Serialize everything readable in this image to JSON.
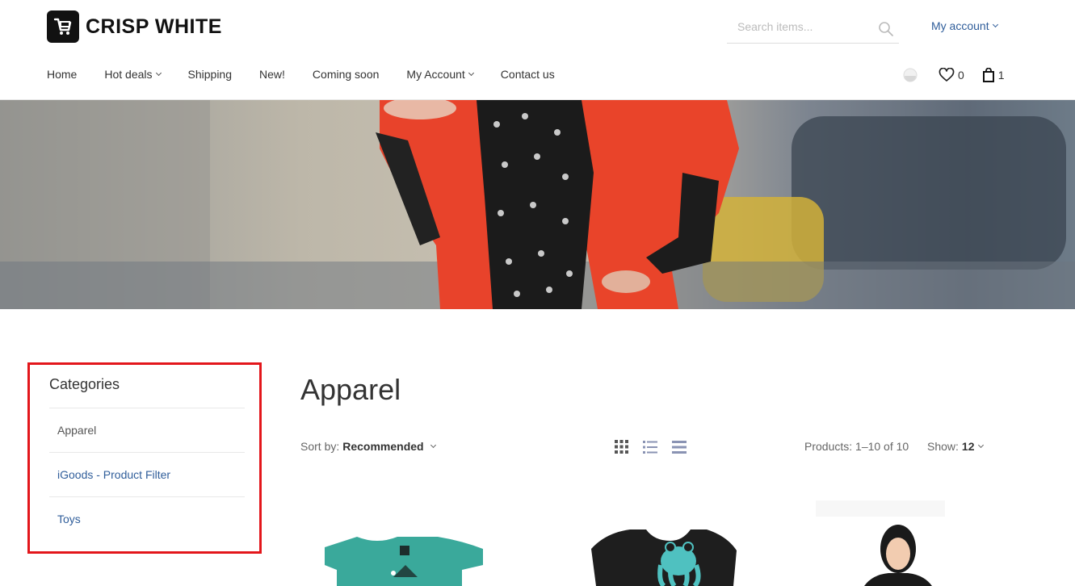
{
  "brand": {
    "name": "CRISP WHITE"
  },
  "search": {
    "placeholder": "Search items..."
  },
  "account_menu": {
    "label": "My account"
  },
  "nav": {
    "items": [
      {
        "label": "Home",
        "has_dropdown": false
      },
      {
        "label": "Hot deals",
        "has_dropdown": true
      },
      {
        "label": "Shipping",
        "has_dropdown": false
      },
      {
        "label": "New!",
        "has_dropdown": false
      },
      {
        "label": "Coming soon",
        "has_dropdown": false
      },
      {
        "label": "My Account",
        "has_dropdown": true
      },
      {
        "label": "Contact us",
        "has_dropdown": false
      }
    ],
    "wishlist_count": "0",
    "cart_count": "1"
  },
  "sidebar": {
    "title": "Categories",
    "items": [
      {
        "label": "Apparel",
        "active": true
      },
      {
        "label": "iGoods - Product Filter",
        "active": false
      },
      {
        "label": "Toys",
        "active": false
      }
    ],
    "highlight_color": "#e3161b"
  },
  "main": {
    "title": "Apparel",
    "sort": {
      "label": "Sort by:",
      "value": "Recommended"
    },
    "products_count": "Products: 1–10 of 10",
    "show": {
      "label": "Show:",
      "value": "12"
    }
  },
  "colors": {
    "link": "#2f5d9a",
    "text": "#333333"
  }
}
